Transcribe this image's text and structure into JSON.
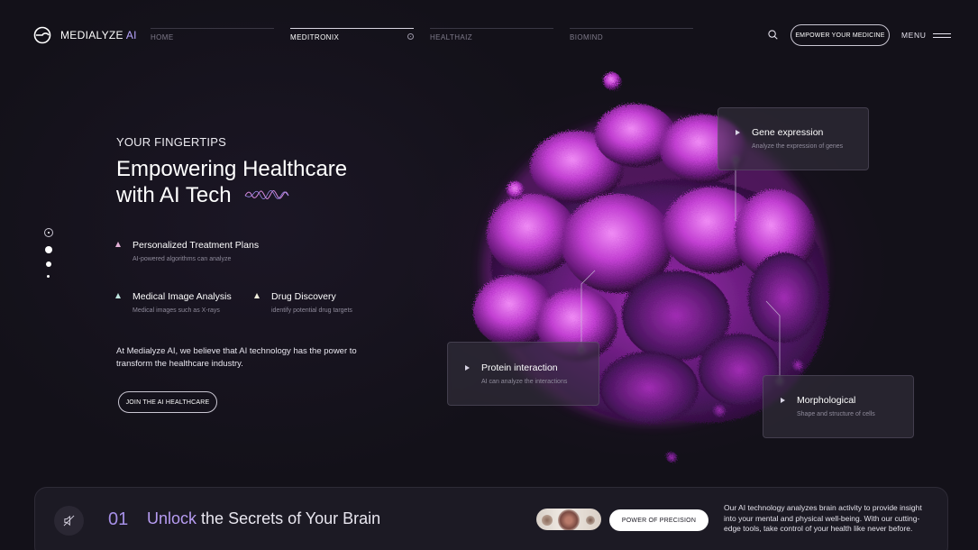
{
  "brand": {
    "name": "MEDIALYZE",
    "suffix": "AI",
    "accent": "#b9a6ff"
  },
  "nav": {
    "items": [
      {
        "label": "HOME",
        "active": false
      },
      {
        "label": "MEDITRONIX",
        "active": true
      },
      {
        "label": "HEALTHAIZ",
        "active": false
      },
      {
        "label": "BIOMIND",
        "active": false
      }
    ]
  },
  "header": {
    "search_icon": "search-icon",
    "cta_label": "EMPOWER YOUR MEDICINE",
    "menu_label": "MENU"
  },
  "hero": {
    "eyebrow": "YOUR FINGERTIPS",
    "headline_line1": "Empowering Healthcare",
    "headline_line2": "with AI Tech",
    "features": [
      {
        "title": "Personalized Treatment Plans",
        "subtitle": "AI-powered algorithms can analyze"
      },
      {
        "title": "Medical Image Analysis",
        "subtitle": "Medical images such as X-rays"
      },
      {
        "title": "Drug Discovery",
        "subtitle": "identify potential drug targets"
      }
    ],
    "paragraph": "At Medialyze AI, we believe that AI technology has the power to transform the healthcare industry.",
    "join_label": "JOIN THE AI HEALTHCARE"
  },
  "cards": {
    "gene": {
      "title": "Gene expression",
      "subtitle": "Analyze the expression of genes"
    },
    "protein": {
      "title": "Protein interaction",
      "subtitle": "AI can analyze the interactions"
    },
    "morph": {
      "title": "Morphological",
      "subtitle": "Shape and structure of cells"
    }
  },
  "bottom": {
    "step_number": "01",
    "title_highlight": "Unlock",
    "title_rest": "the Secrets of Your Brain",
    "precision_label": "POWER OF PRECISION",
    "paragraph": "Our AI technology analyzes brain activity to provide insight into your mental and physical well-being. With our cutting-edge tools, take control of your health like never before."
  },
  "colors": {
    "background": "#131119",
    "accent_purple": "#a58fe6",
    "molecule_magenta": "#c43ad6"
  }
}
